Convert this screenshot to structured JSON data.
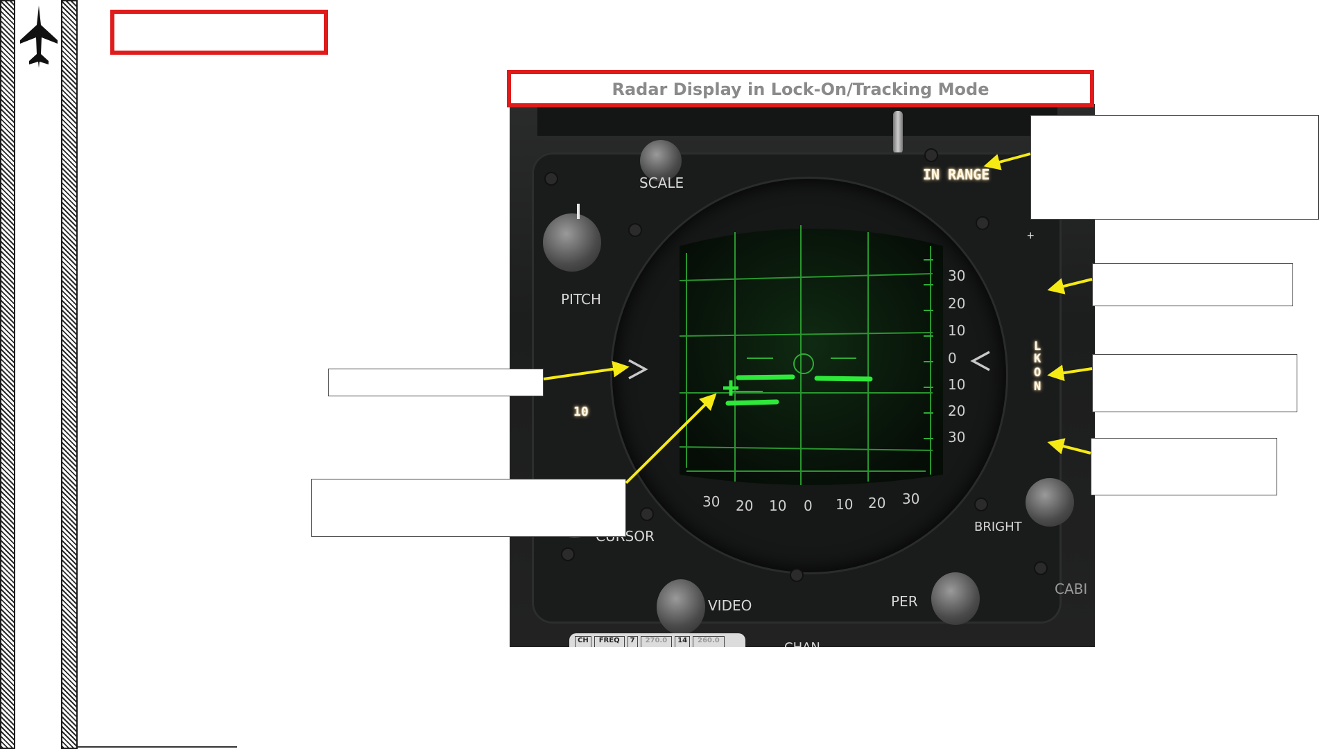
{
  "page": {
    "title": "Radar Display in Lock-On/Tracking Mode",
    "top_left_box_text": ""
  },
  "panel": {
    "scale_label": "SCALE",
    "pitch_label": "PITCH",
    "cursor_label": "CURSOR",
    "bright_label": "BRIGHT",
    "video_label": "VIDEO",
    "per_label": "PER",
    "cabin_label": "CABI",
    "chan_label": "CHAN",
    "in_range_label": "IN RANGE",
    "lk_on_label": [
      "L",
      "K",
      "O",
      "N"
    ],
    "range_readout": "10",
    "right_scale_values": [
      "30",
      "20",
      "10",
      "0",
      "10",
      "20",
      "30"
    ],
    "bottom_scale_values": [
      "30",
      "20",
      "10",
      "0",
      "10",
      "20",
      "30"
    ],
    "plate_cells": [
      "CH",
      "FREQ",
      "7",
      "270.0",
      "14",
      "260.0"
    ]
  },
  "callouts": {
    "in_range_note": "",
    "upper_right_note": "",
    "lkon_note": "",
    "lower_right_note": "",
    "left_indicator_note": "",
    "target_symbol_note": ""
  },
  "colors": {
    "title_border": "#e01b1b",
    "radar_green": "#2ee83a",
    "arrow_yellow": "#f5ea14",
    "panel_dark": "#1e1f1f"
  },
  "icons": {
    "logo": "fighter-jet-icon"
  }
}
